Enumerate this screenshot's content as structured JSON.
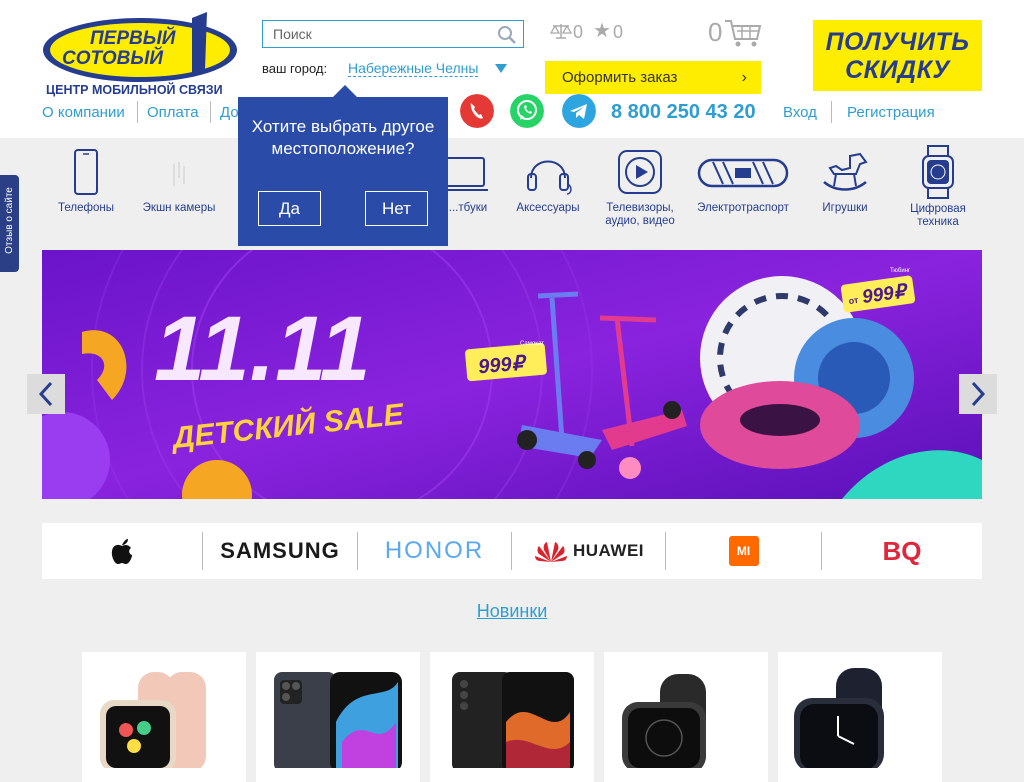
{
  "header": {
    "logo": {
      "line1": "ПЕРВЫЙ",
      "line2": "СОТОВЫЙ",
      "tagline": "ЦЕНТР МОБИЛЬНОЙ СВЯЗИ"
    },
    "search": {
      "placeholder": "Поиск",
      "icon": "search-icon"
    },
    "city": {
      "label": "ваш город:",
      "value": "Набережные Челны"
    },
    "compare_count": "0",
    "favorites_count": "0",
    "cart_count": "0",
    "order_button": "Оформить заказ",
    "discount_banner": {
      "line1": "ПОЛУЧИТЬ",
      "line2": "СКИДКУ"
    },
    "nav": [
      "О компании",
      "Оплата",
      "До"
    ],
    "phone": "8 800 250 43 20",
    "auth": {
      "login": "Вход",
      "register": "Регистрация"
    }
  },
  "city_popup": {
    "question": "Хотите выбрать другое местоположение?",
    "yes": "Да",
    "no": "Нет"
  },
  "categories": [
    "Телефоны",
    "Экшн камеры",
    "...тбуки",
    "Аксессуары",
    "Телевизоры, аудио, видео",
    "Электротраспорт",
    "Игрушки",
    "Цифровая техника"
  ],
  "feedback_tab": "Отзыв о сайте",
  "banner": {
    "title": "11.11",
    "subtitle": "ДЕТСКИЙ SALE",
    "price_tag_1": "999₽",
    "price_tag_2_prefix": "от",
    "price_tag_2": "999₽",
    "small_label_1": "Самокат",
    "small_label_2": "Тюбинг"
  },
  "brands": [
    "SAMSUNG",
    "HONOR",
    "HUAWEI",
    "MI",
    "BQ"
  ],
  "section_title": "Новинки",
  "colors": {
    "accent": "#2f9dd0",
    "navy": "#263d8f",
    "yellow": "#ffed00",
    "popup": "#2a4ca8"
  }
}
